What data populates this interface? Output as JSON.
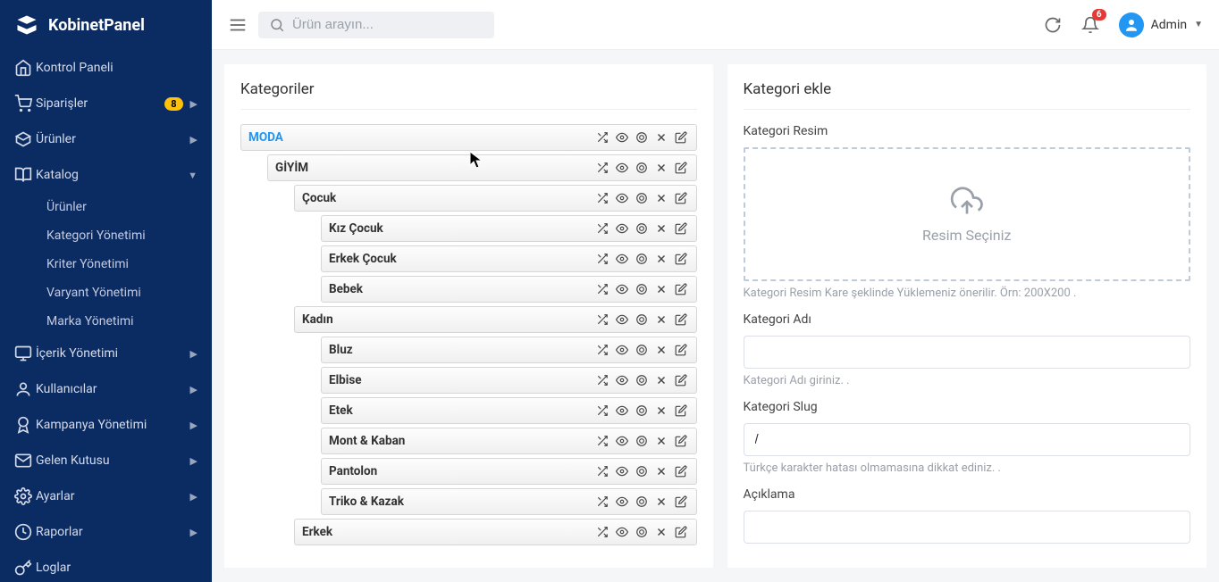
{
  "brand": {
    "name": "KobinetPanel"
  },
  "search": {
    "placeholder": "Ürün arayın..."
  },
  "topbar": {
    "notify_count": "6",
    "user_name": "Admin"
  },
  "sidebar": {
    "items": [
      {
        "label": "Kontrol Paneli",
        "icon": "home"
      },
      {
        "label": "Siparişler",
        "icon": "cart",
        "badge": "8",
        "chev": true
      },
      {
        "label": "Ürünler",
        "icon": "box",
        "chev": true
      },
      {
        "label": "Katalog",
        "icon": "book",
        "chev": true,
        "expanded": true,
        "children": [
          {
            "label": "Ürünler"
          },
          {
            "label": "Kategori Yönetimi"
          },
          {
            "label": "Kriter Yönetimi"
          },
          {
            "label": "Varyant Yönetimi"
          },
          {
            "label": "Marka Yönetimi"
          }
        ]
      },
      {
        "label": "İçerik Yönetimi",
        "icon": "monitor",
        "chev": true
      },
      {
        "label": "Kullanıcılar",
        "icon": "user",
        "chev": true
      },
      {
        "label": "Kampanya Yönetimi",
        "icon": "award",
        "chev": true
      },
      {
        "label": "Gelen Kutusu",
        "icon": "mail",
        "chev": true
      },
      {
        "label": "Ayarlar",
        "icon": "gear",
        "chev": true
      },
      {
        "label": "Raporlar",
        "icon": "clock",
        "chev": true
      },
      {
        "label": "Loglar",
        "icon": "key"
      }
    ]
  },
  "categories": {
    "title": "Kategoriler",
    "rows": [
      {
        "label": "MODA",
        "level": 0,
        "active": true
      },
      {
        "label": "GİYİM",
        "level": 1
      },
      {
        "label": "Çocuk",
        "level": 2
      },
      {
        "label": "Kız Çocuk",
        "level": 3
      },
      {
        "label": "Erkek Çocuk",
        "level": 3
      },
      {
        "label": "Bebek",
        "level": 3
      },
      {
        "label": "Kadın",
        "level": 2
      },
      {
        "label": "Bluz",
        "level": 3
      },
      {
        "label": "Elbise",
        "level": 3
      },
      {
        "label": "Etek",
        "level": 3
      },
      {
        "label": "Mont & Kaban",
        "level": 3
      },
      {
        "label": "Pantolon",
        "level": 3
      },
      {
        "label": "Triko & Kazak",
        "level": 3
      },
      {
        "label": "Erkek",
        "level": 2
      }
    ]
  },
  "form": {
    "title": "Kategori ekle",
    "image_label": "Kategori Resim",
    "dropzone_text": "Resim Seçiniz",
    "image_help": "Kategori Resim Kare şeklinde Yüklemeniz önerilir. Örn: 200X200 .",
    "name_label": "Kategori Adı",
    "name_value": "",
    "name_help": "Kategori Adı giriniz. .",
    "slug_label": "Kategori Slug",
    "slug_value": "/",
    "slug_help": "Türkçe karakter hatası olmamasına dikkat ediniz. .",
    "desc_label": "Açıklama"
  }
}
